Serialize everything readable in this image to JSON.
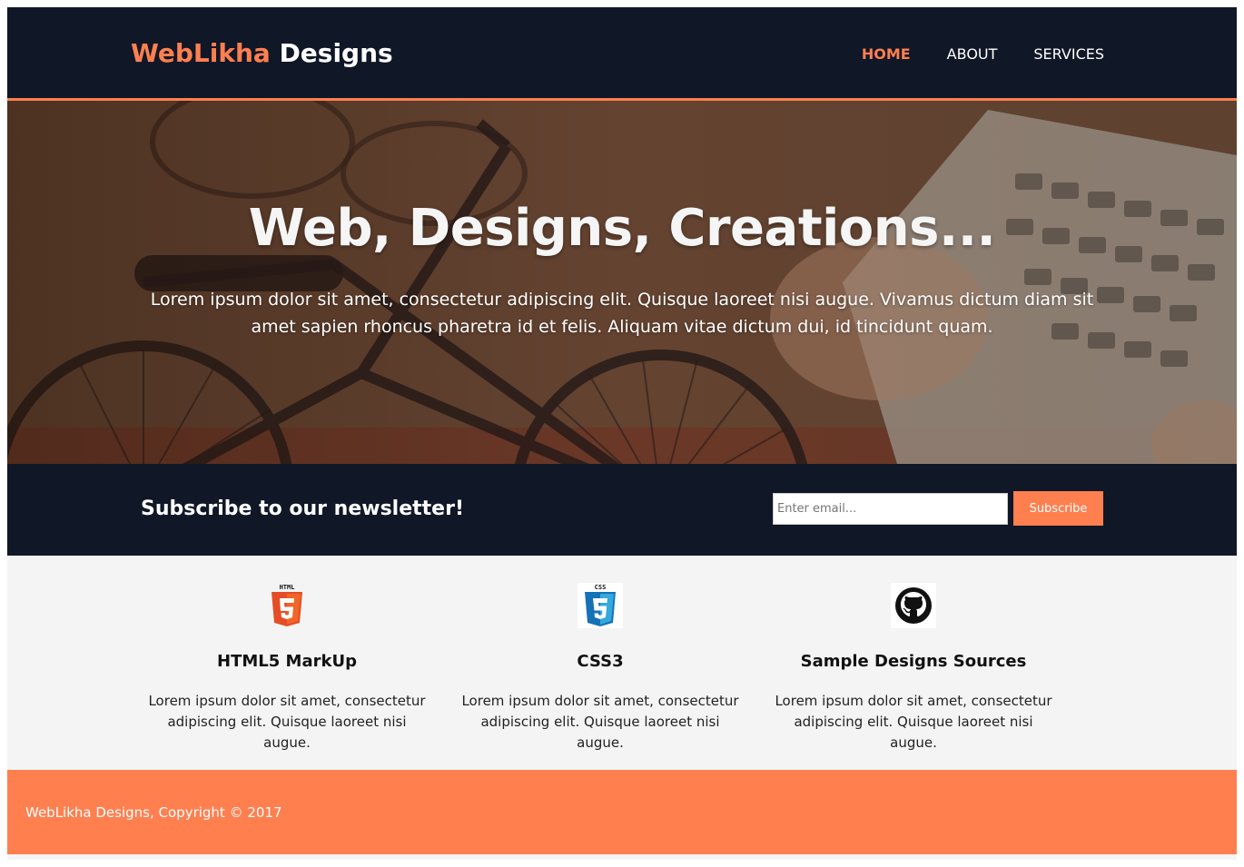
{
  "header": {
    "logo_accent": "WebLikha",
    "logo_rest": "Designs",
    "nav": [
      {
        "label": "Home",
        "active": true
      },
      {
        "label": "About",
        "active": false
      },
      {
        "label": "Services",
        "active": false
      }
    ]
  },
  "hero": {
    "title": "Web, Designs, Creations...",
    "text": "Lorem ipsum dolor sit amet, consectetur adipiscing elit. Quisque laoreet nisi augue. Vivamus dictum diam sit amet sapien rhoncus pharetra id et felis. Aliquam vitae dictum dui, id tincidunt quam."
  },
  "newsletter": {
    "heading": "Subscribe to our newsletter!",
    "email_placeholder": "Enter email...",
    "email_value": "",
    "button_label": "Subscribe"
  },
  "features": [
    {
      "icon": "html5-icon",
      "title": "HTML5 MarkUp",
      "text": "Lorem ipsum dolor sit amet, consectetur adipiscing elit. Quisque laoreet nisi augue."
    },
    {
      "icon": "css3-icon",
      "title": "CSS3",
      "text": "Lorem ipsum dolor sit amet, consectetur adipiscing elit. Quisque laoreet nisi augue."
    },
    {
      "icon": "github-icon",
      "title": "Sample Designs Sources",
      "text": "Lorem ipsum dolor sit amet, consectetur adipiscing elit. Quisque laoreet nisi augue."
    }
  ],
  "footer": {
    "copyright": "WebLikha Designs, Copyright © 2017"
  },
  "colors": {
    "accent": "#ff7f4f",
    "dark": "#101727",
    "light_bg": "#f4f4f4"
  }
}
